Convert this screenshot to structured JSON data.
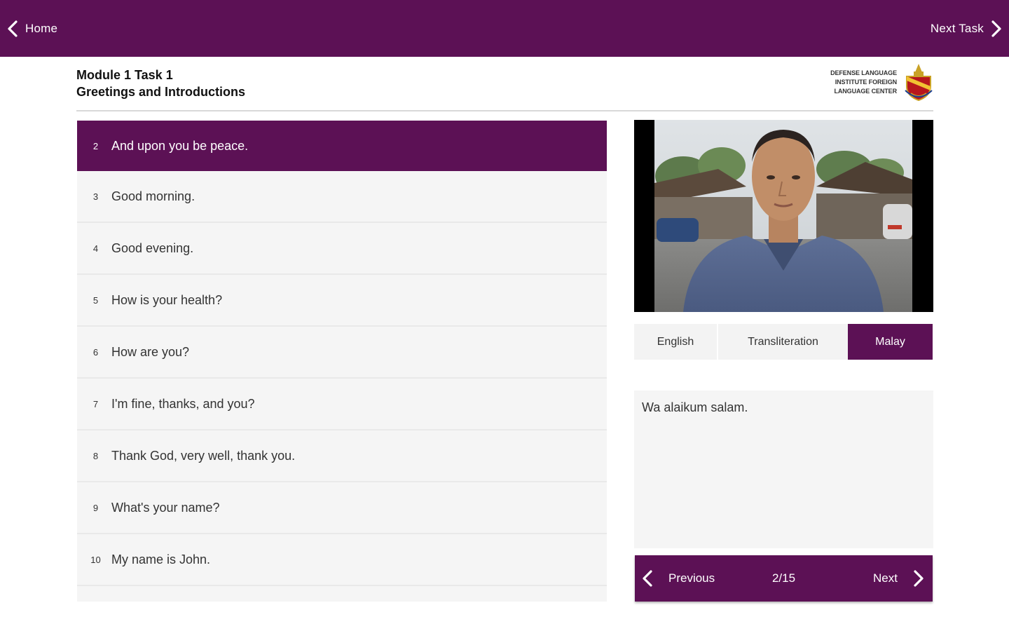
{
  "topbar": {
    "home_label": "Home",
    "next_task_label": "Next Task"
  },
  "header": {
    "module": "Module 1 Task 1",
    "title": "Greetings and Introductions",
    "logo_lines": [
      "Defense Language",
      "Institute Foreign",
      "Language Center"
    ]
  },
  "phrases": [
    {
      "num": "2",
      "text": "And upon you be peace.",
      "active": true
    },
    {
      "num": "3",
      "text": "Good morning."
    },
    {
      "num": "4",
      "text": "Good evening."
    },
    {
      "num": "5",
      "text": "How is your health?"
    },
    {
      "num": "6",
      "text": "How are you?"
    },
    {
      "num": "7",
      "text": "I'm fine, thanks, and you?"
    },
    {
      "num": "8",
      "text": "Thank God, very well, thank you."
    },
    {
      "num": "9",
      "text": "What's your name?"
    },
    {
      "num": "10",
      "text": "My name is John."
    }
  ],
  "tabs": {
    "english": "English",
    "transliteration": "Transliteration",
    "malay": "Malay",
    "selected": "Malay"
  },
  "translation": {
    "text": "Wa alaikum salam."
  },
  "pager": {
    "previous_label": "Previous",
    "next_label": "Next",
    "count": "2/15"
  },
  "colors": {
    "brand": "#5c1155",
    "panel": "#f5f5f5"
  },
  "icons": {
    "back": "chevron-left-icon",
    "forward": "chevron-right-icon"
  }
}
